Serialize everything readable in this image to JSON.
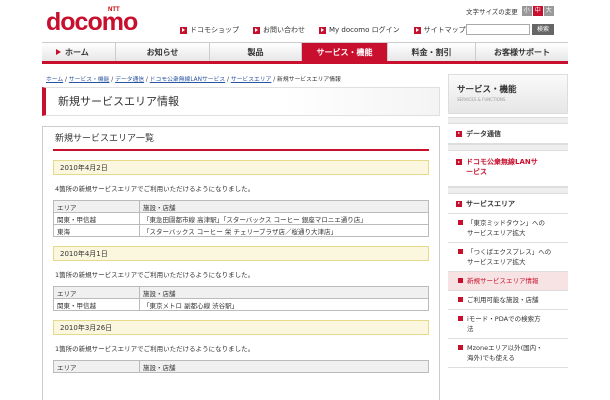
{
  "logo": {
    "ntt": "NTT",
    "main": "docomo"
  },
  "util_links": [
    "ドコモショップ",
    "お問い合わせ",
    "My docomo ログイン",
    "サイトマップ"
  ],
  "font_size": {
    "label": "文字サイズの変更",
    "small": "小",
    "medium": "中",
    "large": "大"
  },
  "search": {
    "button": "検索",
    "value": ""
  },
  "nav": [
    "ホーム",
    "お知らせ",
    "製品",
    "サービス・機能",
    "料金・割引",
    "お客様サポート"
  ],
  "breadcrumb": {
    "items": [
      "ホーム",
      "サービス・機能",
      "データ通信",
      "ドコモ公衆無線LANサービス",
      "サービスエリア"
    ],
    "current": "新規サービスエリア情報",
    "sep": " / "
  },
  "page_title": "新規サービスエリア情報",
  "section_title": "新規サービスエリア一覧",
  "blocks": [
    {
      "date": "2010年4月2日",
      "text": "4箇所の新規サービスエリアでご利用いただけるようになりました。",
      "header": [
        "エリア",
        "施設・店舗"
      ],
      "rows": [
        [
          "関東・甲信越",
          "「東急田園都市線 高津駅」「スターバックス コーヒー 銀座マロニエ通り店」"
        ],
        [
          "東海",
          "「スターバックス コーヒー 栄 チェリーブラザ店／桜通り大津店」"
        ]
      ]
    },
    {
      "date": "2010年4月1日",
      "text": "1箇所の新規サービスエリアでご利用いただけるようになりました。",
      "header": [
        "エリア",
        "施設・店舗"
      ],
      "rows": [
        [
          "関東・甲信越",
          "「東京メトロ 副都心線 渋谷駅」"
        ]
      ]
    },
    {
      "date": "2010年3月26日",
      "text": "1箇所の新規サービスエリアでご利用いただけるようになりました。",
      "header": [
        "エリア",
        "施設・店舗"
      ],
      "rows": []
    }
  ],
  "sidebar": {
    "title": "サービス・機能",
    "subtitle": "SERVICES & FUNCTIONS",
    "cat1": "データ通信",
    "cat2_lines": [
      "ドコモ公衆無線LANサ",
      "ービス"
    ],
    "cat3": "サービスエリア",
    "items": [
      {
        "lines": [
          "「東京ミッドタウン」への",
          "サービスエリア拡大"
        ]
      },
      {
        "lines": [
          "「つくばエクスプレス」への",
          "サービスエリア拡大"
        ]
      },
      {
        "lines": [
          "新規サービスエリア情報"
        ]
      },
      {
        "lines": [
          "ご利用可能な施設・店舗"
        ]
      },
      {
        "lines": [
          "iモード・PDAでの検索方",
          "法"
        ]
      },
      {
        "lines": [
          "Mzoneエリア以外(国内・",
          "海外)でも使える"
        ]
      }
    ]
  },
  "colors": {
    "brand": "#c8102e"
  }
}
